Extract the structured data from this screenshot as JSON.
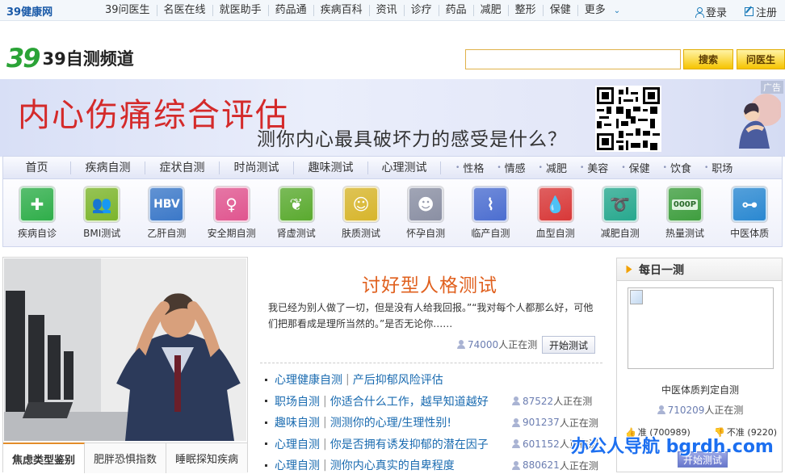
{
  "topbar": {
    "logo_text": "39健康网",
    "nav": [
      "39问医生",
      "名医在线",
      "就医助手",
      "药品通",
      "疾病百科",
      "资讯",
      "诊疗",
      "药品",
      "减肥",
      "整形",
      "保健",
      "更多"
    ],
    "login": "登录",
    "register": "注册"
  },
  "header": {
    "brand_mark": "39",
    "brand_text": "39自测频道",
    "search_placeholder": "",
    "search_button": "搜索",
    "ask_button": "问医生"
  },
  "banner": {
    "title": "内心伤痛综合评估",
    "subtitle": "测你内心最具破坏力的感受是什么？",
    "ad_tag": "广告"
  },
  "nav": {
    "main": [
      "首页",
      "疾病自测",
      "症状自测",
      "时尚测试",
      "趣味测试",
      "心理测试"
    ],
    "minor": [
      "性格",
      "情感",
      "减肥",
      "美容",
      "保健",
      "饮食",
      "职场"
    ]
  },
  "tools": [
    {
      "label": "疾病自诊",
      "color": "#2fae4a",
      "icon": "cross-icon"
    },
    {
      "label": "BMI测试",
      "color": "#7cb52b",
      "icon": "people-icon"
    },
    {
      "label": "乙肝自测",
      "color": "#3b78c8",
      "icon": "hbv-icon"
    },
    {
      "label": "安全期自测",
      "color": "#e0558f",
      "icon": "female-icon"
    },
    {
      "label": "肾虚测试",
      "color": "#5aaa2f",
      "icon": "kidney-icon"
    },
    {
      "label": "肤质测试",
      "color": "#d7b52b",
      "icon": "face-icon"
    },
    {
      "label": "怀孕自测",
      "color": "#8a8fa3",
      "icon": "baby-icon"
    },
    {
      "label": "临产自测",
      "color": "#4c6ed0",
      "icon": "pregnant-icon"
    },
    {
      "label": "血型自测",
      "color": "#d83838",
      "icon": "blood-icon"
    },
    {
      "label": "减肥自测",
      "color": "#27a88e",
      "icon": "tape-icon"
    },
    {
      "label": "热量测试",
      "color": "#3f9e3f",
      "icon": "scale-icon"
    },
    {
      "label": "中医体质",
      "color": "#2a88d1",
      "icon": "stethoscope-icon"
    }
  ],
  "hbv_text": "HBV",
  "scale_text": "000P",
  "left": {
    "tabs": [
      "焦虑类型鉴别",
      "肥胖恐惧指数",
      "睡眠探知疾病"
    ]
  },
  "feature": {
    "title": "讨好型人格测试",
    "desc": "我已经为别人做了一切，但是没有人给我回报。”“我对每个人都那么好，可他们把那看成是理所当然的。”是否无论你……",
    "count": "74000",
    "count_suffix": "人正在测",
    "start": "开始测试"
  },
  "list": [
    {
      "cat": "心理健康自测",
      "title": "产后抑郁风险评估",
      "count": ""
    },
    {
      "cat": "职场自测",
      "title": "你适合什么工作，越早知道越好",
      "count": "87522"
    },
    {
      "cat": "趣味自测",
      "title": "测测你的心理/生理性别!",
      "count": "901237"
    },
    {
      "cat": "心理自测",
      "title": "你是否拥有诱发抑郁的潜在因子",
      "count": "601152"
    },
    {
      "cat": "心理自测",
      "title": "测你内心真实的自卑程度",
      "count": "880621"
    }
  ],
  "count_suffix": "人正在测",
  "daily": {
    "header": "每日一测",
    "name": "中医体质判定自测",
    "count": "710209",
    "count_suffix": "人正在测",
    "yes": "准 (700989)",
    "no": "不准 (9220)",
    "start": "开始测试"
  },
  "watermark": "办公人导航 bgrdh.com"
}
